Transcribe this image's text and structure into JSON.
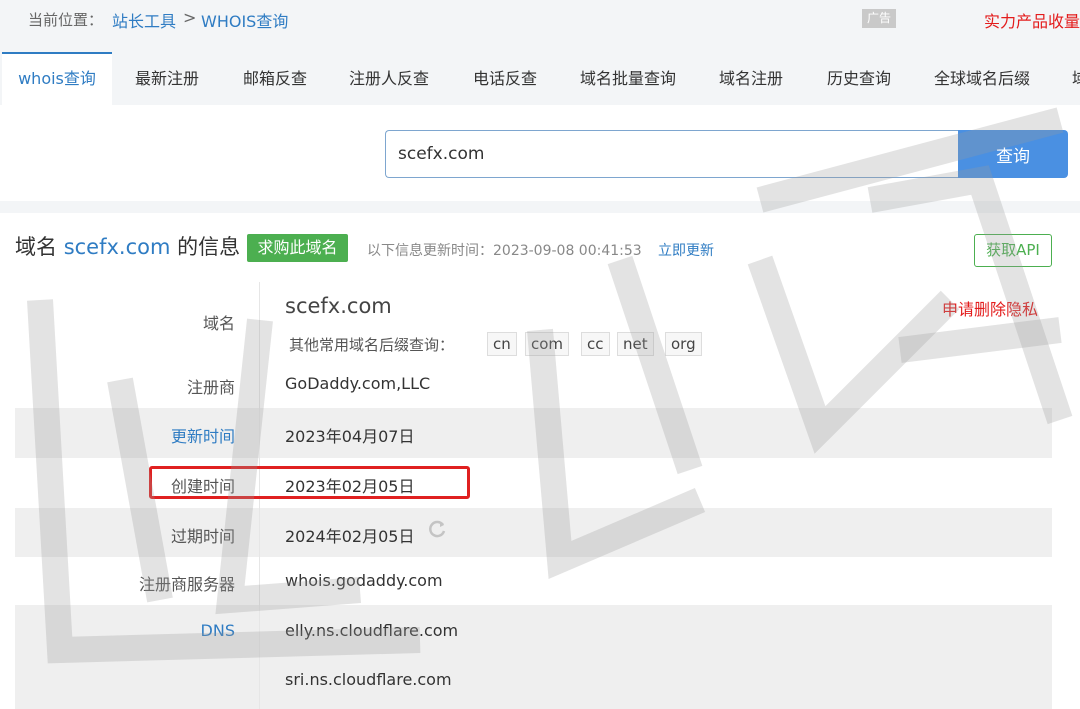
{
  "breadcrumb": {
    "prefix": "当前位置：",
    "items": [
      "站长工具",
      "WHOIS查询"
    ],
    "separator": ">"
  },
  "ad_badge": "广告",
  "promo_text": "实力产品收量",
  "tabs": [
    {
      "label": "whois查询",
      "active": true
    },
    {
      "label": "最新注册"
    },
    {
      "label": "邮箱反查"
    },
    {
      "label": "注册人反查"
    },
    {
      "label": "电话反查"
    },
    {
      "label": "域名批量查询"
    },
    {
      "label": "域名注册"
    },
    {
      "label": "历史查询"
    },
    {
      "label": "全球域名后缀"
    },
    {
      "label": "域"
    }
  ],
  "search": {
    "value": "scefx.com",
    "button_label": "查询"
  },
  "info": {
    "heading_prefix": "域名",
    "heading_domain": "scefx.com",
    "heading_suffix": "的信息",
    "buy_label": "求购此域名",
    "update_text": "以下信息更新时间：2023-09-08 00:41:53",
    "update_link": "立即更新",
    "api_label": "获取API"
  },
  "whois": {
    "domain_label": "域名",
    "domain_value": "scefx.com",
    "delete_privacy": "申请删除隐私",
    "suffix_label": "其他常用域名后缀查询：",
    "suffixes": [
      "cn",
      "com",
      "cc",
      "net",
      "org"
    ],
    "registrar_label": "注册商",
    "registrar_value": "GoDaddy.com,LLC",
    "updated_label": "更新时间",
    "updated_value": "2023年04月07日",
    "created_label": "创建时间",
    "created_value": "2023年02月05日",
    "expires_label": "过期时间",
    "expires_value": "2024年02月05日",
    "server_label": "注册商服务器",
    "server_value": "whois.godaddy.com",
    "dns_label": "DNS",
    "dns_values": [
      "elly.ns.cloudflare.com",
      "sri.ns.cloudflare.com"
    ]
  },
  "colors": {
    "accent_blue": "#2f7cc3",
    "button_blue": "#4a90e2",
    "green": "#4caf50",
    "red": "#e31c1c"
  }
}
